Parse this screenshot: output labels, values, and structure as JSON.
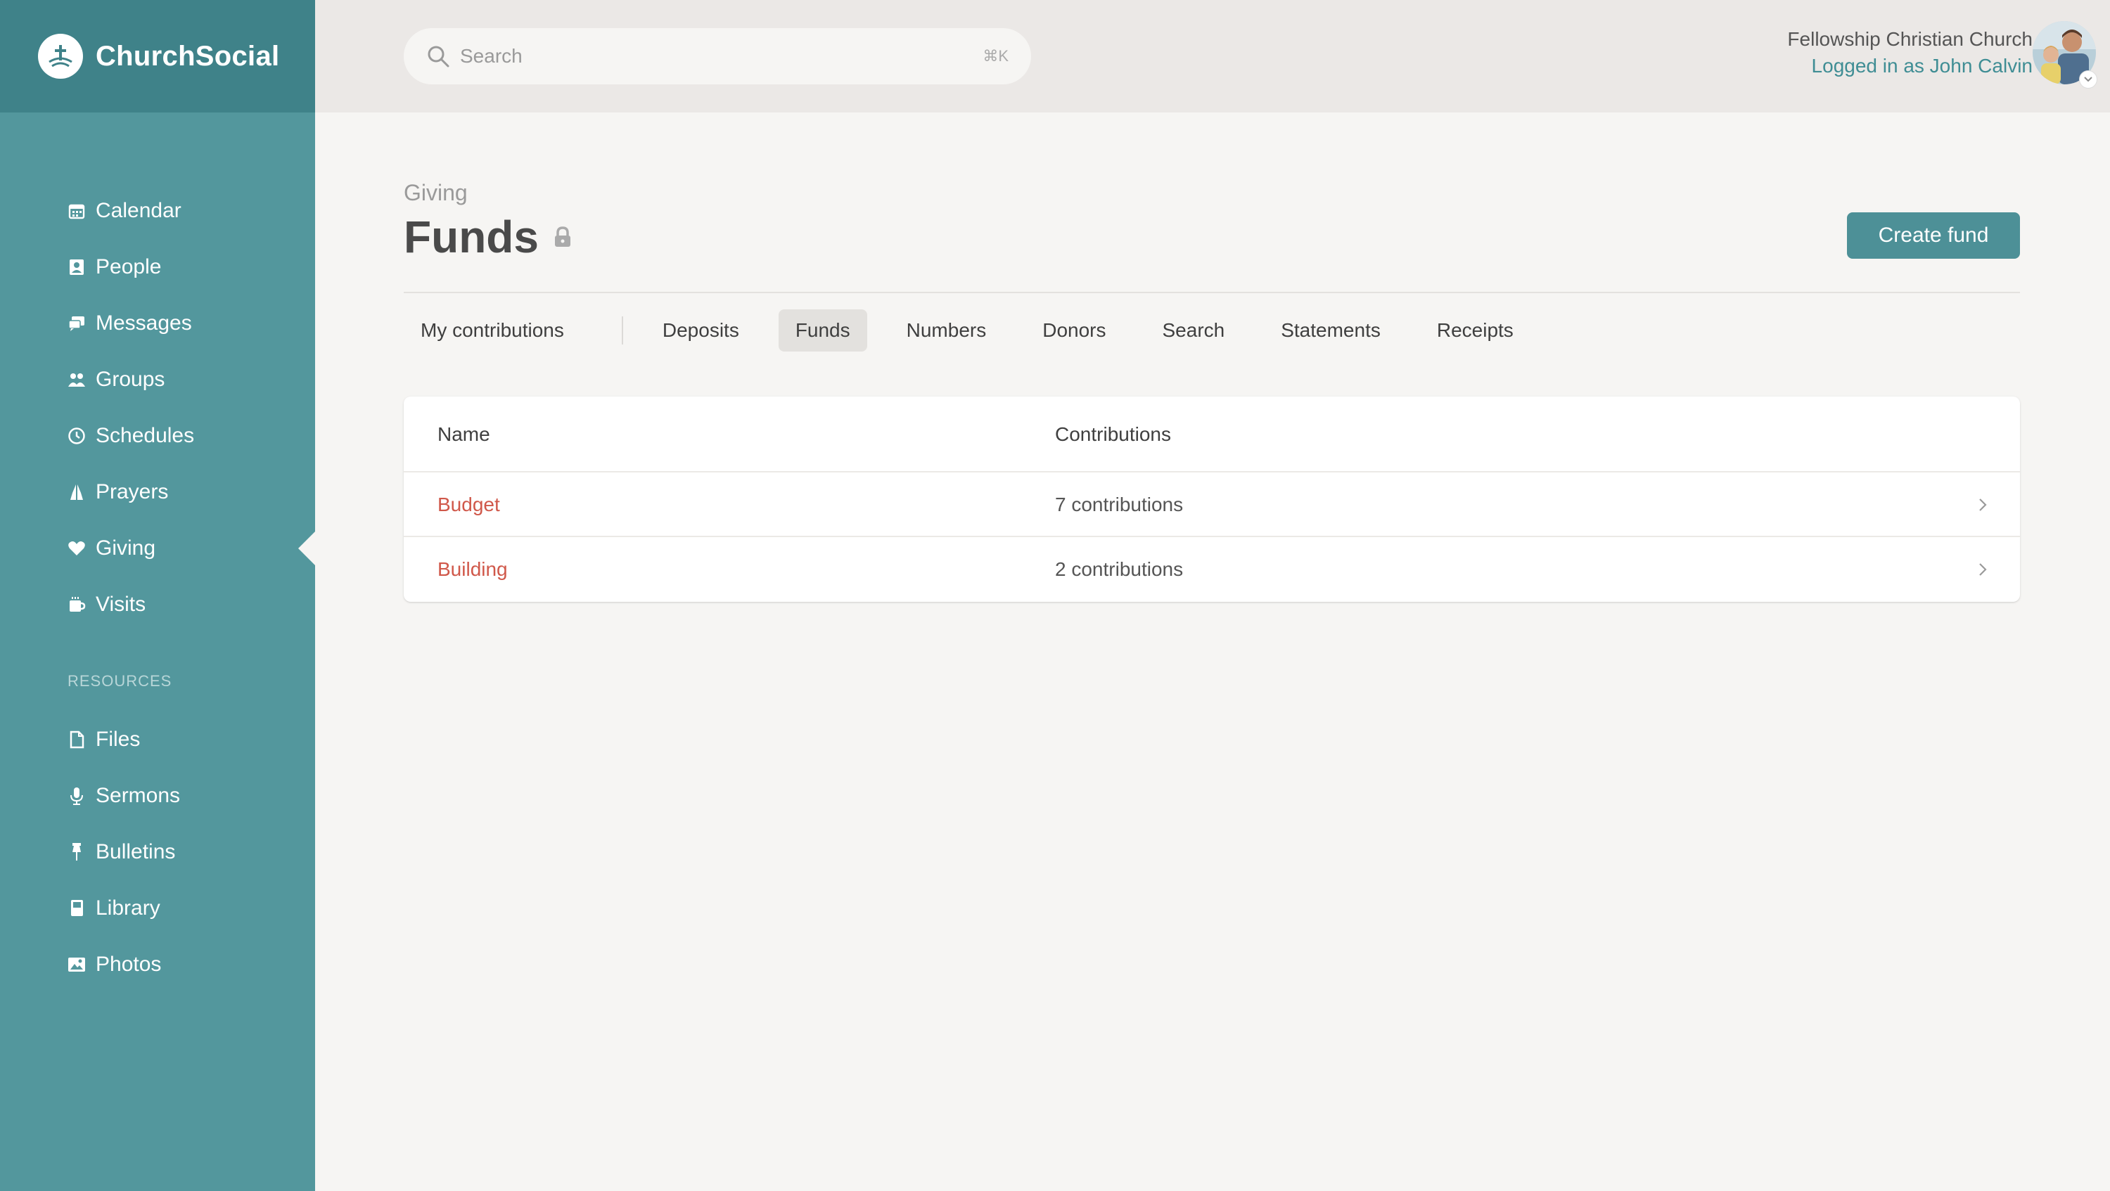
{
  "app": {
    "brand": "ChurchSocial"
  },
  "sidebar": {
    "items": [
      {
        "label": "Calendar",
        "icon": "calendar-icon"
      },
      {
        "label": "People",
        "icon": "person-card-icon"
      },
      {
        "label": "Messages",
        "icon": "chat-icon"
      },
      {
        "label": "Groups",
        "icon": "group-icon"
      },
      {
        "label": "Schedules",
        "icon": "clock-icon"
      },
      {
        "label": "Prayers",
        "icon": "praying-hands-icon"
      },
      {
        "label": "Giving",
        "icon": "heart-icon",
        "active": true
      },
      {
        "label": "Visits",
        "icon": "mug-icon"
      }
    ],
    "section_label": "RESOURCES",
    "resources": [
      {
        "label": "Files",
        "icon": "file-icon"
      },
      {
        "label": "Sermons",
        "icon": "microphone-icon"
      },
      {
        "label": "Bulletins",
        "icon": "pin-icon"
      },
      {
        "label": "Library",
        "icon": "book-icon"
      },
      {
        "label": "Photos",
        "icon": "image-icon"
      }
    ]
  },
  "topbar": {
    "search_placeholder": "Search",
    "search_shortcut": "⌘K",
    "org_name": "Fellowship Christian Church",
    "logged_in": "Logged in as John Calvin"
  },
  "page": {
    "breadcrumb": "Giving",
    "title": "Funds",
    "create_button": "Create fund"
  },
  "tabs": [
    {
      "label": "My contributions"
    },
    {
      "label": "Deposits"
    },
    {
      "label": "Funds",
      "active": true
    },
    {
      "label": "Numbers"
    },
    {
      "label": "Donors"
    },
    {
      "label": "Search"
    },
    {
      "label": "Statements"
    },
    {
      "label": "Receipts"
    }
  ],
  "table": {
    "headers": {
      "name": "Name",
      "contributions": "Contributions"
    },
    "rows": [
      {
        "name": "Budget",
        "contributions": "7 contributions"
      },
      {
        "name": "Building",
        "contributions": "2 contributions"
      }
    ]
  },
  "colors": {
    "sidebar": "#53979d",
    "brand_bar": "#3f8289",
    "accent": "#4d9097",
    "link_red": "#d0584a"
  }
}
